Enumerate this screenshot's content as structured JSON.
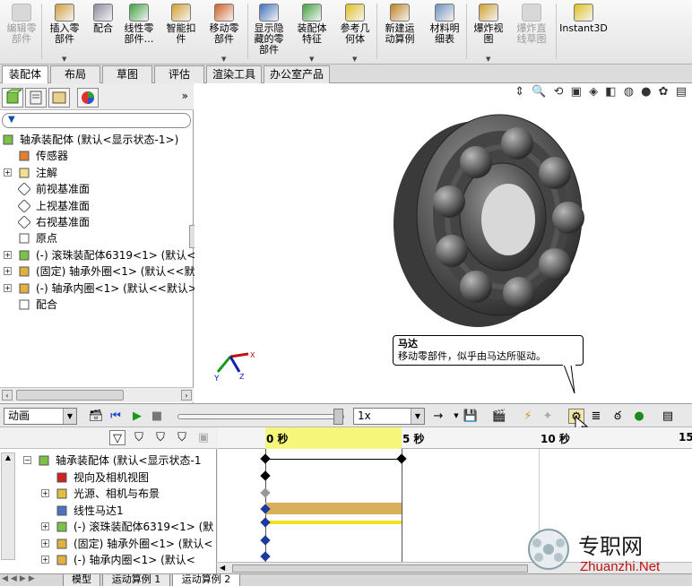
{
  "ribbon": {
    "buttons": [
      {
        "label": "编辑零\n部件",
        "disabled": true,
        "icon": "edit-component-icon"
      },
      {
        "label": "插入零\n部件",
        "disabled": false,
        "icon": "insert-component-icon"
      },
      {
        "label": "配合",
        "disabled": false,
        "icon": "mate-icon"
      },
      {
        "label": "线性零\n部件…",
        "disabled": false,
        "icon": "linear-pattern-icon"
      },
      {
        "label": "智能扣\n件",
        "disabled": false,
        "icon": "smart-fastener-icon"
      },
      {
        "label": "移动零\n部件",
        "disabled": false,
        "icon": "move-component-icon"
      },
      {
        "label": "显示隐\n藏的零\n部件",
        "disabled": false,
        "icon": "show-hidden-icon"
      },
      {
        "label": "装配体\n特征",
        "disabled": false,
        "icon": "assembly-feature-icon"
      },
      {
        "label": "参考几\n何体",
        "disabled": false,
        "icon": "reference-geometry-icon"
      },
      {
        "label": "新建运\n动算例",
        "disabled": false,
        "icon": "new-motion-study-icon"
      },
      {
        "label": "材料明\n细表",
        "disabled": false,
        "icon": "bom-icon"
      },
      {
        "label": "爆炸视\n图",
        "disabled": false,
        "icon": "exploded-view-icon"
      },
      {
        "label": "爆炸直\n线草图",
        "disabled": true,
        "icon": "explode-line-sketch-icon"
      },
      {
        "label": "Instant3D",
        "disabled": false,
        "icon": "instant3d-icon"
      }
    ]
  },
  "tabs": [
    "装配体",
    "布局",
    "草图",
    "评估",
    "渲染工具",
    "办公室产品"
  ],
  "feature_tree": {
    "root": "轴承装配体  (默认<显示状态-1>)",
    "items": [
      {
        "label": "传感器",
        "icon": "sensor-icon",
        "expand": ""
      },
      {
        "label": "注解",
        "icon": "annotation-icon",
        "expand": "+"
      },
      {
        "label": "前视基准面",
        "icon": "plane-icon",
        "expand": ""
      },
      {
        "label": "上视基准面",
        "icon": "plane-icon",
        "expand": ""
      },
      {
        "label": "右视基准面",
        "icon": "plane-icon",
        "expand": ""
      },
      {
        "label": "原点",
        "icon": "origin-icon",
        "expand": ""
      },
      {
        "label": "(-) 滚珠装配体6319<1> (默认<",
        "icon": "subassembly-icon",
        "expand": "+"
      },
      {
        "label": "(固定) 轴承外圈<1> (默认<<默",
        "icon": "part-icon",
        "expand": "+"
      },
      {
        "label": "(-) 轴承内圈<1> (默认<<默认>",
        "icon": "part-icon",
        "expand": "+"
      },
      {
        "label": "配合",
        "icon": "mates-folder-icon",
        "expand": ""
      }
    ]
  },
  "tooltip": {
    "title": "马达",
    "text": "移动零部件，似乎由马达所驱动。"
  },
  "motion": {
    "study_type": "动画",
    "speed": "1x",
    "timeline_ticks": [
      "0 秒",
      "5 秒",
      "10 秒",
      "15"
    ],
    "tree_root": "轴承装配体  (默认<显示状态-1",
    "tree_items": [
      {
        "label": "视向及相机视图",
        "icon": "camera-view-icon",
        "expand": ""
      },
      {
        "label": "光源、相机与布景",
        "icon": "lights-icon",
        "expand": "+"
      },
      {
        "label": "线性马达1",
        "icon": "motor-icon",
        "expand": ""
      },
      {
        "label": "(-) 滚珠装配体6319<1> (默",
        "icon": "subassembly-icon",
        "expand": "+"
      },
      {
        "label": "(固定) 轴承外圈<1> (默认<",
        "icon": "part-icon",
        "expand": "+"
      },
      {
        "label": "(-) 轴承内圈<1> (默认<",
        "icon": "part-icon",
        "expand": "+"
      }
    ]
  },
  "bottom_tabs": [
    "模型",
    "运动算例 1",
    "运动算例 2"
  ],
  "watermark": {
    "title": "专职网",
    "url": "Zhuanzhi.Net"
  },
  "colors": {
    "timebar": "#f6f67a",
    "motor_bar": "#d8b05a",
    "accent": "#0a4ea8"
  }
}
